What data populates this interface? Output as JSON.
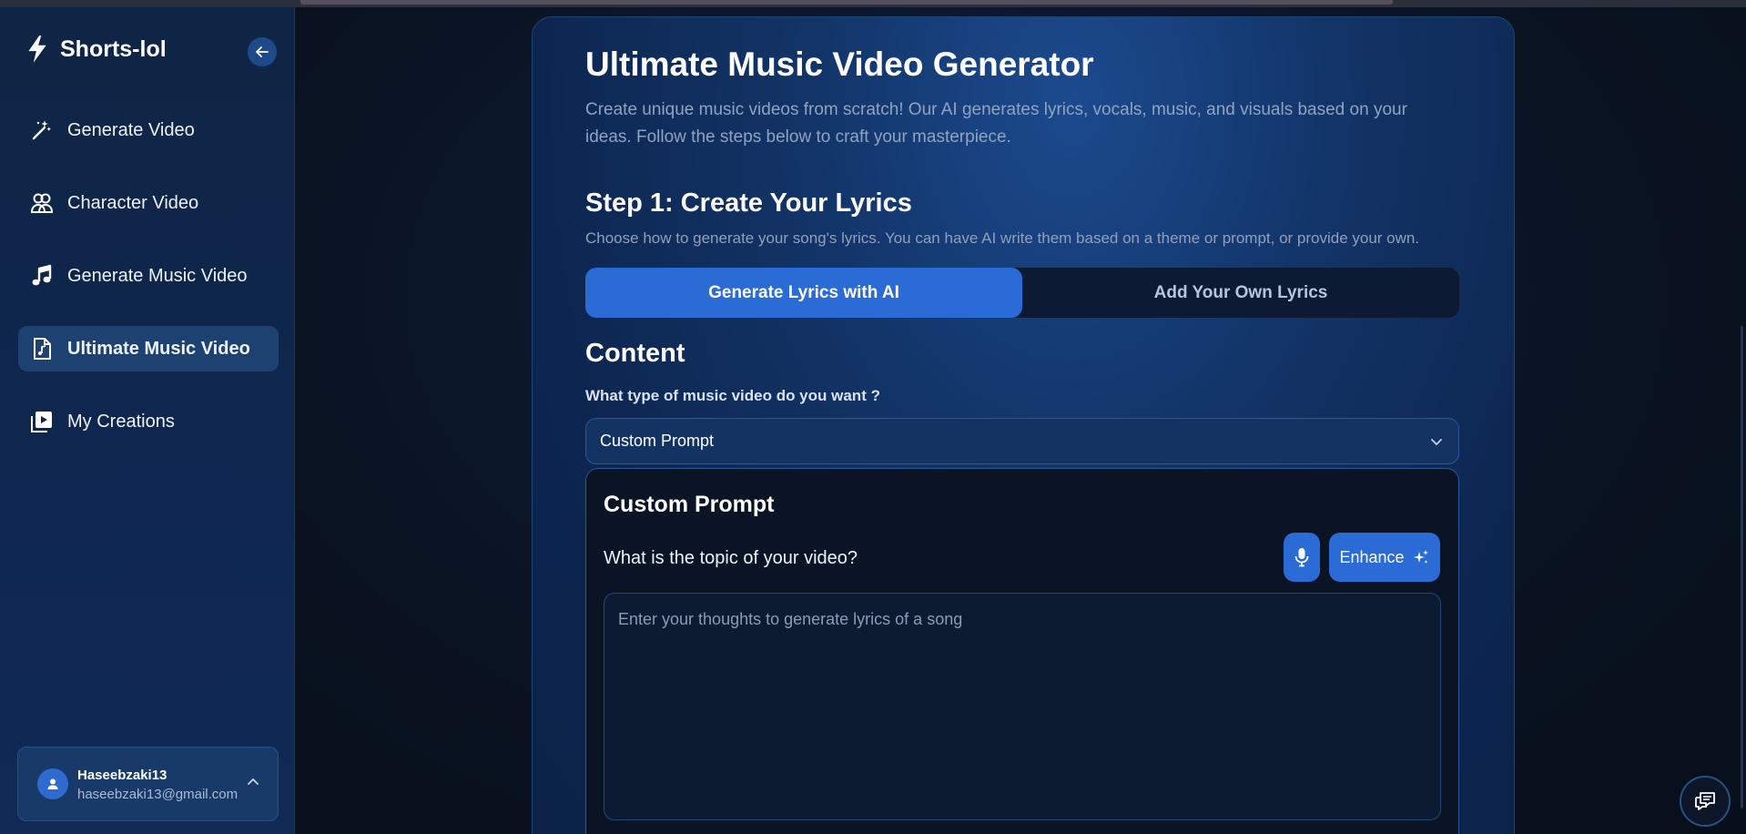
{
  "brand": {
    "name": "Shorts-lol"
  },
  "sidebar": {
    "items": [
      {
        "label": "Generate Video",
        "icon": "magic-wand-icon",
        "active": false
      },
      {
        "label": "Character Video",
        "icon": "users-icon",
        "active": false
      },
      {
        "label": "Generate Music Video",
        "icon": "music-note-icon",
        "active": false
      },
      {
        "label": "Ultimate Music Video",
        "icon": "music-file-icon",
        "active": true
      },
      {
        "label": "My Creations",
        "icon": "video-library-icon",
        "active": false
      }
    ],
    "user": {
      "name": "Haseebzaki13",
      "email": "haseebzaki13@gmail.com"
    }
  },
  "main": {
    "title": "Ultimate Music Video Generator",
    "subtitle": "Create unique music videos from scratch! Our AI generates lyrics, vocals, music, and visuals based on your ideas. Follow the steps below to craft your masterpiece.",
    "step": {
      "title": "Step 1: Create Your Lyrics",
      "description": "Choose how to generate your song's lyrics. You can have AI write them based on a theme or prompt, or provide your own."
    },
    "tabs": [
      {
        "label": "Generate Lyrics with AI",
        "active": true
      },
      {
        "label": "Add Your Own Lyrics",
        "active": false
      }
    ],
    "content": {
      "title": "Content",
      "question": "What type of music video do you want ?",
      "selected_type": "Custom Prompt"
    },
    "prompt": {
      "title": "Custom Prompt",
      "topic_label": "What is the topic of your video?",
      "enhance_label": "Enhance",
      "placeholder": "Enter your thoughts to generate lyrics of a song"
    }
  },
  "colors": {
    "accent": "#2a6bd6",
    "sidebar_bg": "#0f2545",
    "active_nav": "#1d4170",
    "page_bg": "#0a1220"
  }
}
